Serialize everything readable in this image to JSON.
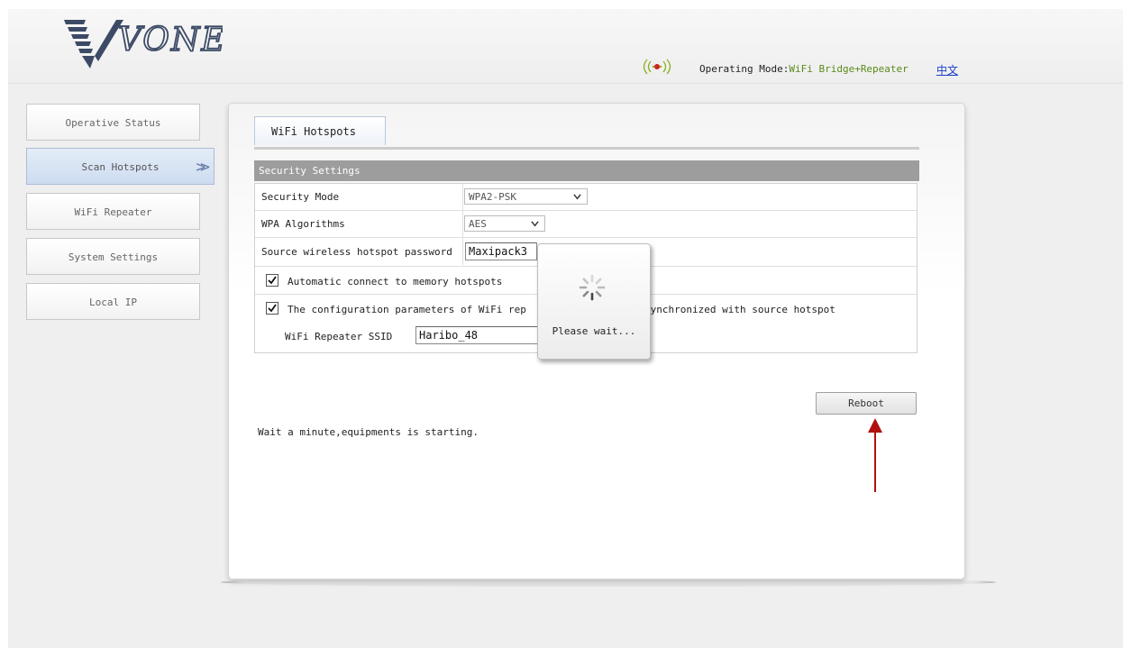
{
  "header": {
    "logo_text": "VONETS",
    "mode_label": "Operating Mode:",
    "mode_value": "WiFi Bridge+Repeater",
    "language_link": "中文",
    "signal_icon": "wifi-signal-icon"
  },
  "sidebar": {
    "items": [
      {
        "label": "Operative Status",
        "active": false
      },
      {
        "label": "Scan Hotspots",
        "active": true
      },
      {
        "label": "WiFi Repeater",
        "active": false
      },
      {
        "label": "System Settings",
        "active": false
      },
      {
        "label": "Local IP",
        "active": false
      }
    ],
    "active_arrow": ">>"
  },
  "panel": {
    "tab_label": "WiFi Hotspots",
    "section_title": "Security Settings",
    "security_mode_label": "Security Mode",
    "security_mode_value": "WPA2-PSK",
    "wpa_algorithms_label": "WPA Algorithms",
    "wpa_algorithms_value": "AES",
    "password_label": "Source wireless hotspot password",
    "password_value": "Maxipack3",
    "auto_connect_label": "Automatic connect to memory hotspots",
    "auto_connect_checked": true,
    "sync_label_prefix": "The configuration parameters of WiFi rep",
    "sync_label_suffix": "synchronized with source hotspot",
    "sync_checked": true,
    "ssid_label": "WiFi Repeater SSID",
    "ssid_value": "Haribo_48",
    "reboot_label": "Reboot",
    "status_message": "Wait a minute,equipments is starting."
  },
  "overlay": {
    "message": "Please wait...",
    "spinner_icon": "loading-spinner-icon"
  },
  "colors": {
    "mode_value": "#5a8a1a",
    "link": "#1a3fc8",
    "section_header": "#9d9d9d",
    "annotation_arrow": "#b01010"
  }
}
